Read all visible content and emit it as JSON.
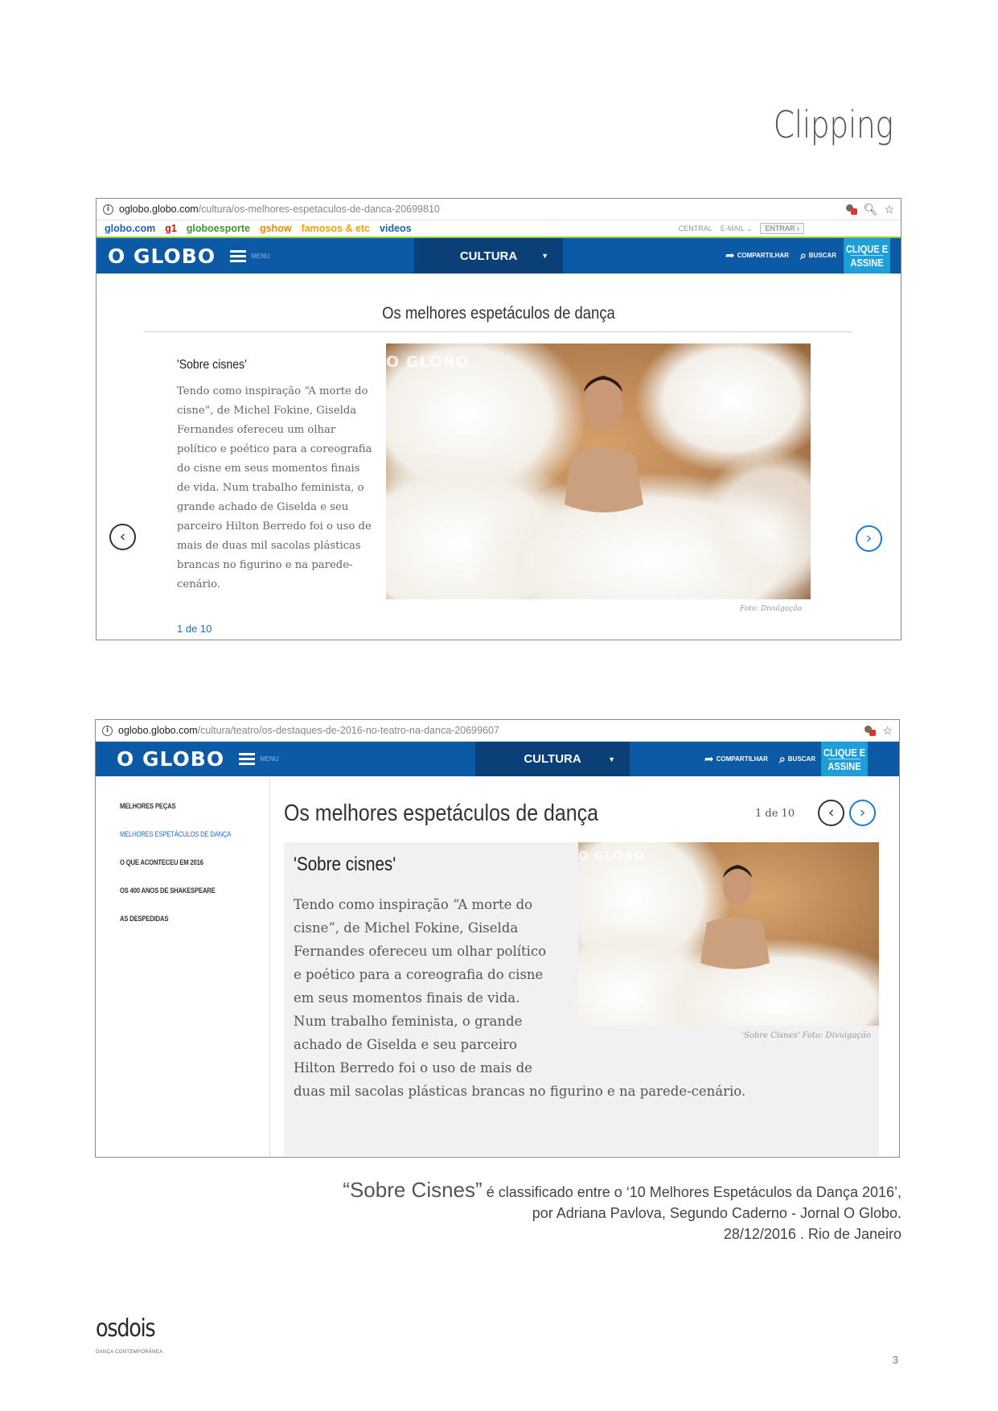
{
  "page": {
    "heading": "Clipping",
    "page_number": "3"
  },
  "shot1": {
    "url_host": "oglobo.globo.com",
    "url_path": "/cultura/os-melhores-espetaculos-de-danca-20699810",
    "links": [
      "globo.com",
      "g1",
      "globoesporte",
      "gshow",
      "famosos & etc",
      "videos"
    ],
    "central": "CENTRAL",
    "email": "E-MAIL",
    "entrar": "ENTRAR",
    "logo": "O GLOBO",
    "menu_label": "MENU",
    "section": "CULTURA",
    "share": "COMPARTILHAR",
    "search": "BUSCAR",
    "cta_line1": "CLIQUE E",
    "cta_line2": "ASSINE",
    "gallery_title": "Os melhores espetáculos de dança",
    "heading": "'Sobre cisnes'",
    "description": "Tendo como inspiração “A morte do cisne”, de Michel Fokine, Giselda Fernandes ofereceu um olhar político e poético para a coreografia do cisne em seus momentos finais de vida. Num trabalho feminista, o grande achado de Giselda e seu parceiro Hilton Berredo foi o uso de mais de duas mil sacolas plásticas brancas no figurino e na parede-cenário.",
    "watermark": "O GLOBO",
    "credit": "Foto: Divulgação",
    "counter": "1 de 10"
  },
  "shot2": {
    "url_host": "oglobo.globo.com",
    "url_path": "/cultura/teatro/os-destaques-de-2016-no-teatro-na-danca-20699607",
    "logo": "O GLOBO",
    "menu_label": "MENU",
    "section": "CULTURA",
    "share": "COMPARTILHAR",
    "search": "BUSCAR",
    "cta_line1": "CLIQUE E",
    "cta_line2": "ASSINE",
    "sidebar": [
      "MELHORES PEÇAS",
      "MELHORES ESPETÁCULOS DE DANÇA",
      "O QUE ACONTECEU EM 2016",
      "OS 400 ANOS DE SHAKESPEARE",
      "AS DESPEDIDAS"
    ],
    "gallery_title": "Os melhores espetáculos de dança",
    "counter": "1 de 10",
    "heading": "'Sobre cisnes'",
    "description": "Tendo como inspiração “A morte do cisne”, de Michel Fokine, Giselda Fernandes ofereceu um olhar político e poético para a coreografia do cisne em seus momentos finais de vida. Num trabalho feminista, o grande achado de Giselda e seu parceiro Hilton Berredo foi o uso de mais de duas mil sacolas plásticas brancas no figurino e na parede-cenário.",
    "watermark": "O GLOBO",
    "credit": "'Sobre Cisnes' Foto: Divulgação"
  },
  "caption": {
    "quote": "“Sobre Cisnes”",
    "line1_rest": " é classificado entre o ‘10 Melhores Espetáculos da Dança 2016’,",
    "line2": "por Adriana Pavlova, Segundo Caderno - Jornal O Globo.",
    "line3": "28/12/2016 . Rio de Janeiro"
  },
  "footer": {
    "brand": "osdois",
    "tagline": "DANÇA CONTEMPORÂNEA"
  },
  "colors": {
    "nav_blue": "#0c5aa6",
    "nav_dark": "#0a3f78",
    "cta_blue": "#1f9fd8",
    "link_blue": "#1c6dc4"
  }
}
